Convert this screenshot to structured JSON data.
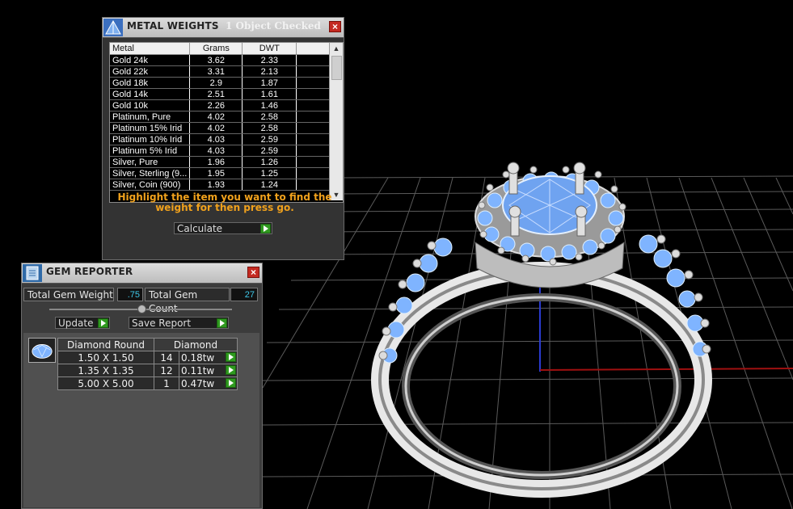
{
  "metal_weights": {
    "title": "METAL WEIGHTS",
    "subtitle": "1 Object Checked",
    "close_label": "×",
    "columns": [
      "Metal",
      "Grams",
      "DWT"
    ],
    "rows": [
      {
        "metal": "Gold 24k",
        "grams": "3.62",
        "dwt": "2.33"
      },
      {
        "metal": "Gold 22k",
        "grams": "3.31",
        "dwt": "2.13"
      },
      {
        "metal": "Gold 18k",
        "grams": "2.9",
        "dwt": "1.87"
      },
      {
        "metal": "Gold 14k",
        "grams": "2.51",
        "dwt": "1.61"
      },
      {
        "metal": "Gold 10k",
        "grams": "2.26",
        "dwt": "1.46"
      },
      {
        "metal": "Platinum, Pure",
        "grams": "4.02",
        "dwt": "2.58"
      },
      {
        "metal": "Platinum 15% Irid",
        "grams": "4.02",
        "dwt": "2.58"
      },
      {
        "metal": "Platinum 10% Irid",
        "grams": "4.03",
        "dwt": "2.59"
      },
      {
        "metal": "Platinum 5% Irid",
        "grams": "4.03",
        "dwt": "2.59"
      },
      {
        "metal": "Silver, Pure",
        "grams": "1.96",
        "dwt": "1.26"
      },
      {
        "metal": "Silver, Sterling (9...",
        "grams": "1.95",
        "dwt": "1.25"
      },
      {
        "metal": "Silver, Coin (900)",
        "grams": "1.93",
        "dwt": "1.24"
      }
    ],
    "message": "Highlight the item you want to find the weight for then press go.",
    "calculate_label": "Calculate"
  },
  "gem_reporter": {
    "title": "GEM REPORTER",
    "close_label": "×",
    "total_weight_label": "Total Gem Weight",
    "total_weight_value": ".75",
    "total_count_label": "Total Gem Count",
    "total_count_value": "27",
    "update_label": "Update",
    "save_report_label": "Save Report",
    "columns": [
      "Diamond Round",
      "Diamond"
    ],
    "rows": [
      {
        "size": "1.50 X 1.50",
        "count": "14",
        "weight": "0.18tw"
      },
      {
        "size": "1.35 X 1.35",
        "count": "12",
        "weight": "0.11tw"
      },
      {
        "size": "5.00 X 5.00",
        "count": "1",
        "weight": "0.47tw"
      }
    ]
  },
  "colors": {
    "accent_orange": "#f0a11c",
    "value_cyan": "#3ec8e8",
    "go_green": "#2f9a1f",
    "close_red": "#c42a21",
    "gem_blue": "#7fb4ff"
  }
}
